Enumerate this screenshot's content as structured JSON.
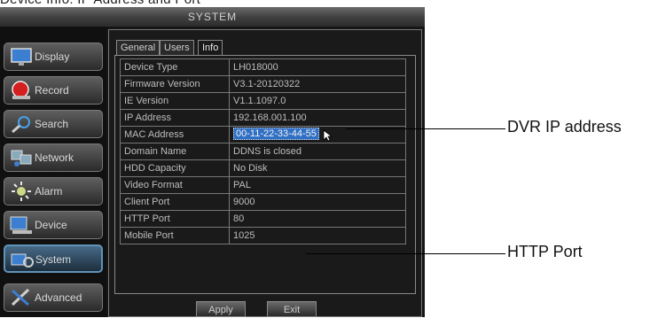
{
  "caption_cut": "Device Info: IP Address and Port",
  "window": {
    "title": "SYSTEM"
  },
  "sidebar": {
    "items": [
      {
        "label": "Display",
        "icon": "monitor-icon"
      },
      {
        "label": "Record",
        "icon": "record-icon"
      },
      {
        "label": "Search",
        "icon": "search-icon"
      },
      {
        "label": "Network",
        "icon": "network-icon"
      },
      {
        "label": "Alarm",
        "icon": "alarm-icon"
      },
      {
        "label": "Device",
        "icon": "device-icon"
      },
      {
        "label": "System",
        "icon": "system-icon",
        "active": true
      },
      {
        "label": "Advanced",
        "icon": "advanced-icon"
      }
    ]
  },
  "tabs": [
    {
      "label": "General"
    },
    {
      "label": "Users"
    },
    {
      "label": "Info",
      "active": true
    }
  ],
  "info": {
    "rows": [
      {
        "key": "Device Type",
        "value": "LH018000"
      },
      {
        "key": "Firmware Version",
        "value": "V3.1-20120322"
      },
      {
        "key": "IE Version",
        "value": "V1.1.1097.0"
      },
      {
        "key": "IP Address",
        "value": "192.168.001.100"
      },
      {
        "key": "MAC Address",
        "value": "00-11-22-33-44-55"
      },
      {
        "key": "Domain Name",
        "value": "DDNS is closed"
      },
      {
        "key": "HDD Capacity",
        "value": "No Disk"
      },
      {
        "key": "Video Format",
        "value": "PAL"
      },
      {
        "key": "Client Port",
        "value": "9000"
      },
      {
        "key": "HTTP Port",
        "value": "80"
      },
      {
        "key": "Mobile Port",
        "value": "1025"
      }
    ]
  },
  "buttons": {
    "apply": "Apply",
    "exit": "Exit"
  },
  "callouts": {
    "ip": "DVR IP address",
    "http": "HTTP Port"
  }
}
